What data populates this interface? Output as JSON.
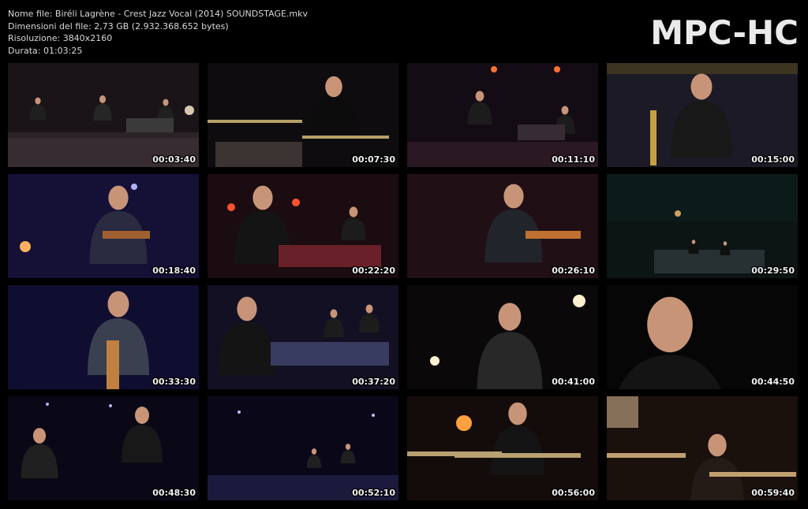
{
  "info": {
    "filename": "Nome file: Biréli Lagrène - Crest Jazz Vocal (2014) SOUNDSTAGE.mkv",
    "filesize": "Dimensioni del file: 2,73 GB (2.932.368.652 bytes)",
    "resolution": "Risoluzione: 3840x2160",
    "duration": "Durata: 01:03:25"
  },
  "logo": "MPC-HC",
  "thumbnails": [
    {
      "time": "00:03:40",
      "scene": "stage-wide",
      "bg": "#1a1418"
    },
    {
      "time": "00:07:30",
      "scene": "drummer",
      "bg": "#0e0c0e"
    },
    {
      "time": "00:11:10",
      "scene": "stage-sax",
      "bg": "#140c14"
    },
    {
      "time": "00:15:00",
      "scene": "saxophonist",
      "bg": "#1c1a26"
    },
    {
      "time": "00:18:40",
      "scene": "guitarist-blue",
      "bg": "#141036"
    },
    {
      "time": "00:22:20",
      "scene": "organist",
      "bg": "#1a0c10"
    },
    {
      "time": "00:26:10",
      "scene": "guitarist-red",
      "bg": "#201016"
    },
    {
      "time": "00:29:50",
      "scene": "stage-far",
      "bg": "#0c1414"
    },
    {
      "time": "00:33:30",
      "scene": "guitarist-blue2",
      "bg": "#100e30"
    },
    {
      "time": "00:37:20",
      "scene": "organist2",
      "bg": "#121022"
    },
    {
      "time": "00:41:00",
      "scene": "harmonica",
      "bg": "#0a0808"
    },
    {
      "time": "00:44:50",
      "scene": "closeup-face",
      "bg": "#060606"
    },
    {
      "time": "00:48:30",
      "scene": "duo",
      "bg": "#0a0816"
    },
    {
      "time": "00:52:10",
      "scene": "stage-wide2",
      "bg": "#0a0818"
    },
    {
      "time": "00:56:00",
      "scene": "drummer-cymbals",
      "bg": "#140c0a"
    },
    {
      "time": "00:59:40",
      "scene": "drummer-closeup",
      "bg": "#1a100c"
    }
  ]
}
